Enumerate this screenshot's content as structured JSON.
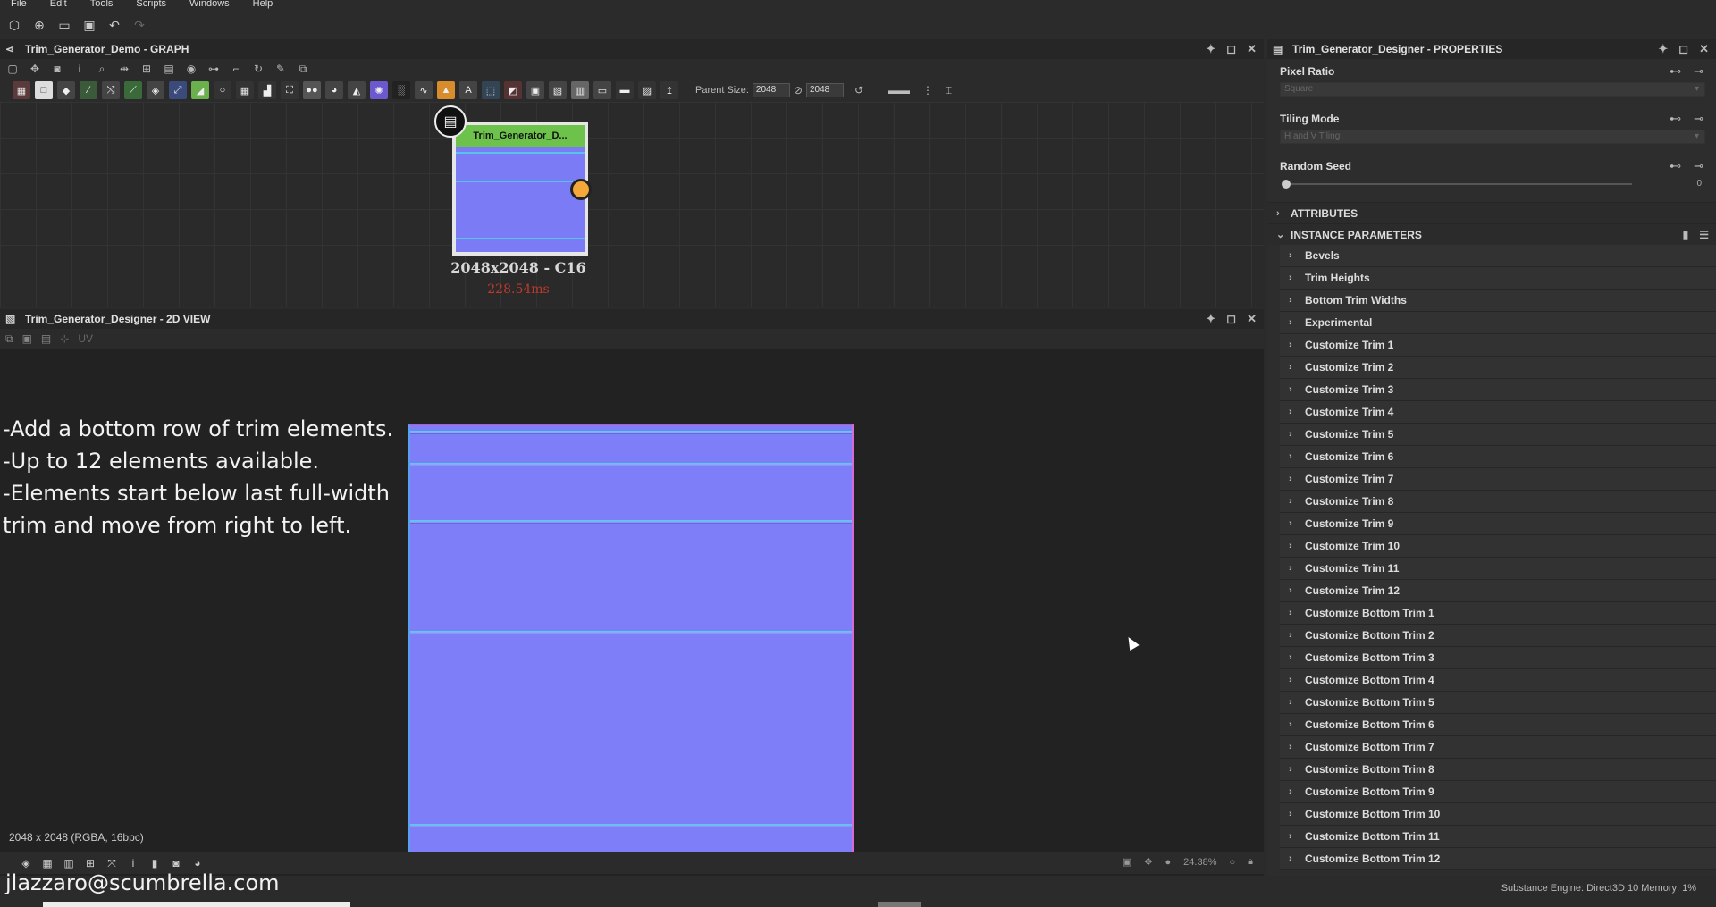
{
  "menu": [
    "File",
    "Edit",
    "Tools",
    "Scripts",
    "Windows",
    "Help"
  ],
  "graph_panel": {
    "title": "Trim_Generator_Demo - GRAPH",
    "parent_size_label": "Parent Size:",
    "parent_size_w": "2048",
    "parent_size_h": "2048",
    "node": {
      "title": "Trim_Generator_D...",
      "resolution": "2048x2048 - C16",
      "time": "228.54ms"
    }
  },
  "view2d": {
    "title": "Trim_Generator_Designer - 2D VIEW",
    "uv_label": "UV",
    "annotation": [
      "-Add a bottom row of trim elements.",
      "-Up to 12 elements available.",
      "-Elements start below last full-width",
      "trim and move from right to left."
    ],
    "size_status": "2048 x 2048 (RGBA, 16bpc)",
    "zoom": "24.38%"
  },
  "footer": {
    "email": "jlazzaro@scumbrella.com",
    "engine": "Substance Engine: Direct3D 10  Memory: 1%"
  },
  "properties": {
    "title": "Trim_Generator_Designer - PROPERTIES",
    "pixel_ratio": {
      "label": "Pixel Ratio",
      "value": "Square"
    },
    "tiling_mode": {
      "label": "Tiling Mode",
      "value": "H and V Tiling"
    },
    "random_seed": {
      "label": "Random Seed",
      "value": "0"
    },
    "attributes_label": "ATTRIBUTES",
    "instance_params_label": "INSTANCE PARAMETERS",
    "params": [
      "Bevels",
      "Trim Heights",
      "Bottom Trim Widths",
      "Experimental",
      "Customize Trim 1",
      "Customize Trim 2",
      "Customize Trim 3",
      "Customize Trim 4",
      "Customize Trim 5",
      "Customize Trim 6",
      "Customize Trim 7",
      "Customize Trim 8",
      "Customize Trim 9",
      "Customize Trim 10",
      "Customize Trim 11",
      "Customize Trim 12",
      "Customize Bottom Trim 1",
      "Customize Bottom Trim 2",
      "Customize Bottom Trim 3",
      "Customize Bottom Trim 4",
      "Customize Bottom Trim 5",
      "Customize Bottom Trim 6",
      "Customize Bottom Trim 7",
      "Customize Bottom Trim 8",
      "Customize Bottom Trim 9",
      "Customize Bottom Trim 10",
      "Customize Bottom Trim 11",
      "Customize Bottom Trim 12"
    ]
  },
  "colors": {
    "node_header": "#6cc24a",
    "normal_map": "#7e7ef8",
    "output_port": "#f4a83a",
    "time_text": "#c0392b"
  },
  "icons": [
    "graph-icon",
    "pin-icon",
    "maximize-icon",
    "close-icon",
    "document-icon",
    "chevron-right-icon",
    "chevron-down-icon",
    "lock-icon"
  ]
}
